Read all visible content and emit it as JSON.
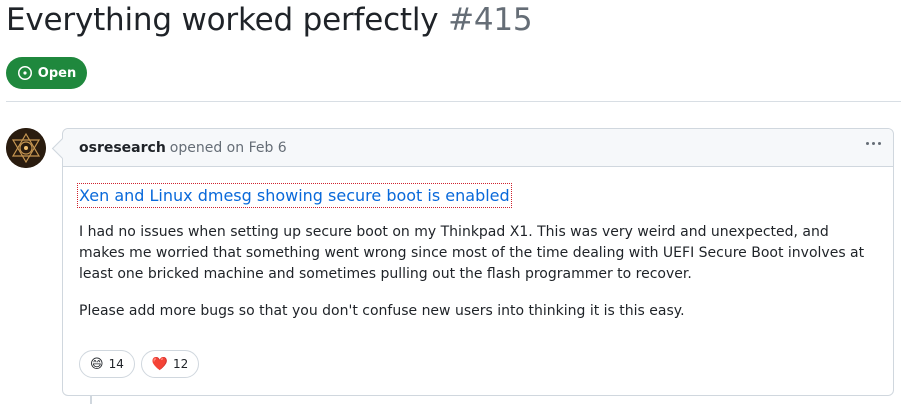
{
  "issue": {
    "title": "Everything worked perfectly",
    "number": "#415",
    "state": "Open",
    "state_color": "#1f883d"
  },
  "comment": {
    "author": "osresearch",
    "opened_text": "opened on Feb 6",
    "menu_icon": "kebab-horizontal-icon",
    "link_text": "Xen and Linux dmesg showing secure boot is enabled",
    "paragraph1": "I had no issues when setting up secure boot on my Thinkpad X1. This was very weird and unexpected, and makes me worried that something went wrong since most of the time dealing with UEFI Secure Boot involves at least one bricked machine and sometimes pulling out the flash programmer to recover.",
    "paragraph2": "Please add more bugs so that you don't confuse new users into thinking it is this easy.",
    "reactions": [
      {
        "emoji": "😄",
        "count": "14"
      },
      {
        "emoji": "❤️",
        "count": "12"
      }
    ]
  },
  "colors": {
    "link": "#0969da",
    "border": "#d0d7de",
    "muted": "#656d76"
  }
}
